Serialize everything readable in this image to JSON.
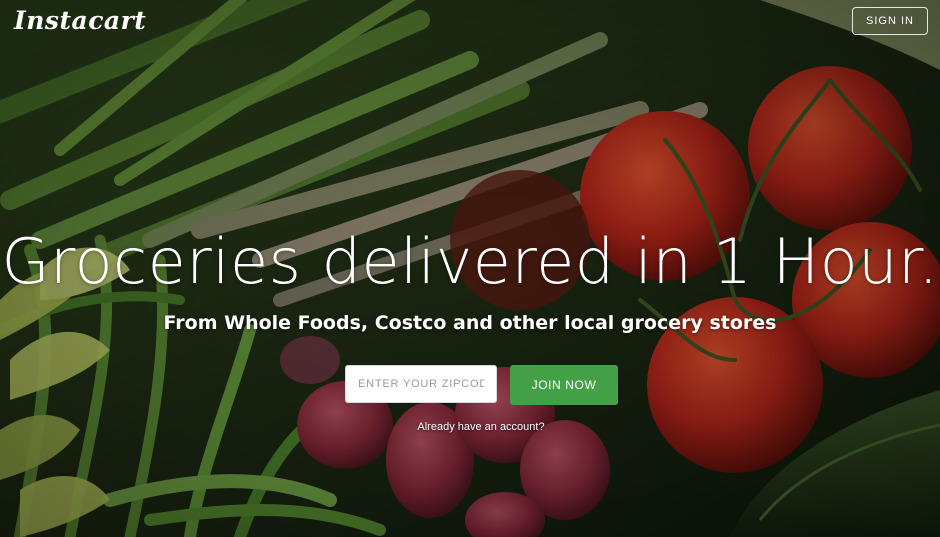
{
  "brand": {
    "logo_text": "Instacart"
  },
  "header": {
    "signin_label": "SIGN IN"
  },
  "hero": {
    "headline": "Groceries delivered in 1 Hour.",
    "subheadline": "From Whole Foods, Costco and other local grocery stores",
    "zip_placeholder": "ENTER YOUR ZIPCODE",
    "zip_value": "",
    "join_label": "JOIN NOW",
    "account_link": "Already have an account?"
  },
  "colors": {
    "join_button": "#43a047",
    "text": "#ffffff"
  }
}
